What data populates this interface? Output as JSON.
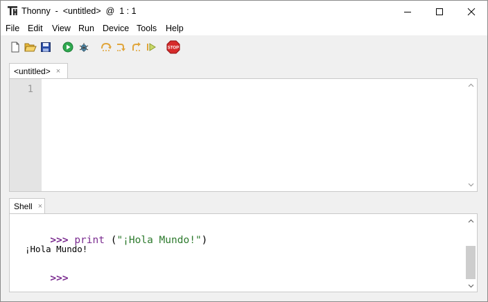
{
  "window": {
    "title": "Thonny  -  <untitled>  @  1 : 1",
    "icon": "thonny-logo-icon"
  },
  "menu": [
    "File",
    "Edit",
    "View",
    "Run",
    "Device",
    "Tools",
    "Help"
  ],
  "toolbar": {
    "icons": [
      "new-file-icon",
      "open-file-icon",
      "save-icon",
      "run-icon",
      "debug-icon",
      "step-over-icon",
      "step-into-icon",
      "step-out-icon",
      "resume-icon",
      "stop-icon"
    ],
    "stop_label": "STOP"
  },
  "editor": {
    "tab_label": "<untitled>",
    "tab_close": "×",
    "line_numbers": [
      "1"
    ]
  },
  "shell": {
    "tab_label": "Shell",
    "tab_close": "×",
    "prompt": ">>>",
    "command_func": "print",
    "command_open": "(",
    "command_string": "\"¡Hola Mundo!\"",
    "command_close": ")",
    "output": "¡Hola Mundo!",
    "prompt2": ">>>"
  },
  "colors": {
    "prompt": "#7a2b8f",
    "string": "#2d7a2d",
    "run_green": "#2fa84f",
    "stop_red": "#d62b2b"
  }
}
